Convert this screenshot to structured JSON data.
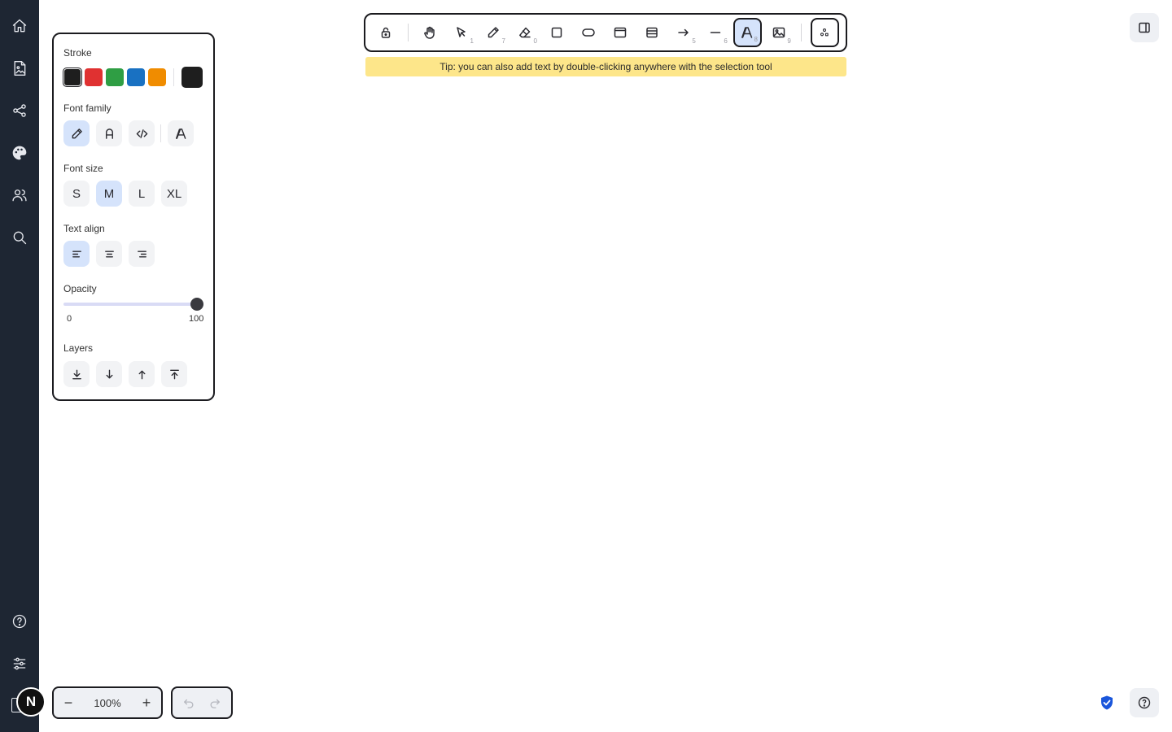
{
  "toolbar": {
    "tools": [
      {
        "name": "lock",
        "key": ""
      },
      {
        "name": "hand",
        "key": ""
      },
      {
        "name": "select",
        "key": "1"
      },
      {
        "name": "pencil",
        "key": "7"
      },
      {
        "name": "eraser",
        "key": "0"
      },
      {
        "name": "rectangle",
        "key": ""
      },
      {
        "name": "ellipse",
        "key": ""
      },
      {
        "name": "frame",
        "key": ""
      },
      {
        "name": "table",
        "key": ""
      },
      {
        "name": "arrow",
        "key": "5"
      },
      {
        "name": "line",
        "key": "6"
      },
      {
        "name": "text",
        "key": "8",
        "active": true
      },
      {
        "name": "image",
        "key": "9"
      }
    ]
  },
  "tip": "Tip: you can also add text by double-clicking anywhere with the selection tool",
  "panel": {
    "stroke_label": "Stroke",
    "stroke_colors": [
      "#1e1e1e",
      "#e03131",
      "#2f9e44",
      "#1971c2",
      "#f08c00"
    ],
    "stroke_custom": "#1e1e1e",
    "font_family_label": "Font family",
    "font_size_label": "Font size",
    "font_sizes": [
      "S",
      "M",
      "L",
      "XL"
    ],
    "font_size_selected": "M",
    "text_align_label": "Text align",
    "opacity_label": "Opacity",
    "opacity_min": "0",
    "opacity_max": "100",
    "opacity_value": 100,
    "layers_label": "Layers"
  },
  "zoom": {
    "value": "100%",
    "minus": "−",
    "plus": "+"
  },
  "avatar": {
    "initial": "N"
  },
  "colors": {
    "rail_bg": "#1e2633",
    "active_tool": "#d5e3fb",
    "tip_bg": "#fde68a",
    "shield": "#1a56db"
  }
}
